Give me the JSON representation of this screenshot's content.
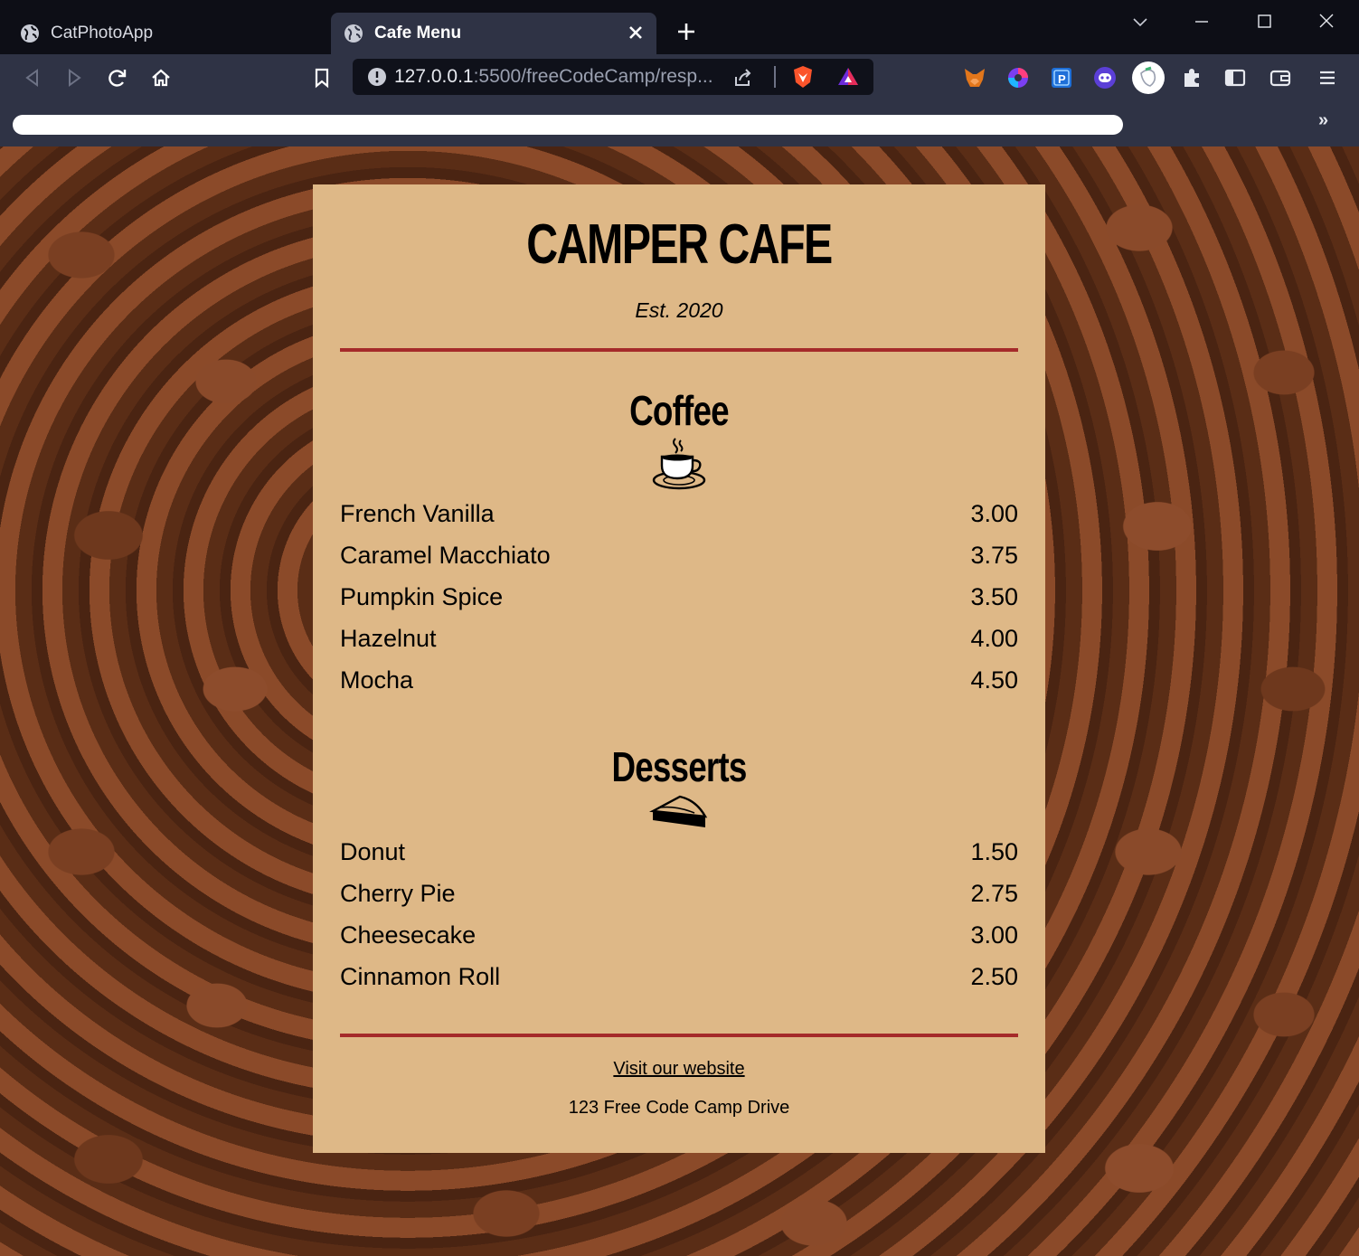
{
  "browser": {
    "tabs": [
      {
        "title": "CatPhotoApp",
        "active": false
      },
      {
        "title": "Cafe Menu",
        "active": true
      }
    ],
    "url": {
      "host": "127.0.0.1",
      "rest": ":5500/freeCodeCamp/resp..."
    },
    "bookmarks_overflow": "»",
    "colors": {
      "chrome_dark": "#0d0e16",
      "chrome": "#2f3345",
      "url_bg": "#0f111a"
    }
  },
  "page": {
    "cafe_name": "CAMPER CAFE",
    "established": "Est. 2020",
    "sections": [
      {
        "title": "Coffee",
        "icon": "coffee-cup-icon",
        "items": [
          {
            "name": "French Vanilla",
            "price": "3.00"
          },
          {
            "name": "Caramel Macchiato",
            "price": "3.75"
          },
          {
            "name": "Pumpkin Spice",
            "price": "3.50"
          },
          {
            "name": "Hazelnut",
            "price": "4.00"
          },
          {
            "name": "Mocha",
            "price": "4.50"
          }
        ]
      },
      {
        "title": "Desserts",
        "icon": "pie-slice-icon",
        "items": [
          {
            "name": "Donut",
            "price": "1.50"
          },
          {
            "name": "Cherry Pie",
            "price": "2.75"
          },
          {
            "name": "Cheesecake",
            "price": "3.00"
          },
          {
            "name": "Cinnamon Roll",
            "price": "2.50"
          }
        ]
      }
    ],
    "footer": {
      "link_text": "Visit our website",
      "address": "123 Free Code Camp Drive"
    },
    "colors": {
      "menu_bg": "#deb887",
      "divider": "#a52a2a"
    }
  }
}
